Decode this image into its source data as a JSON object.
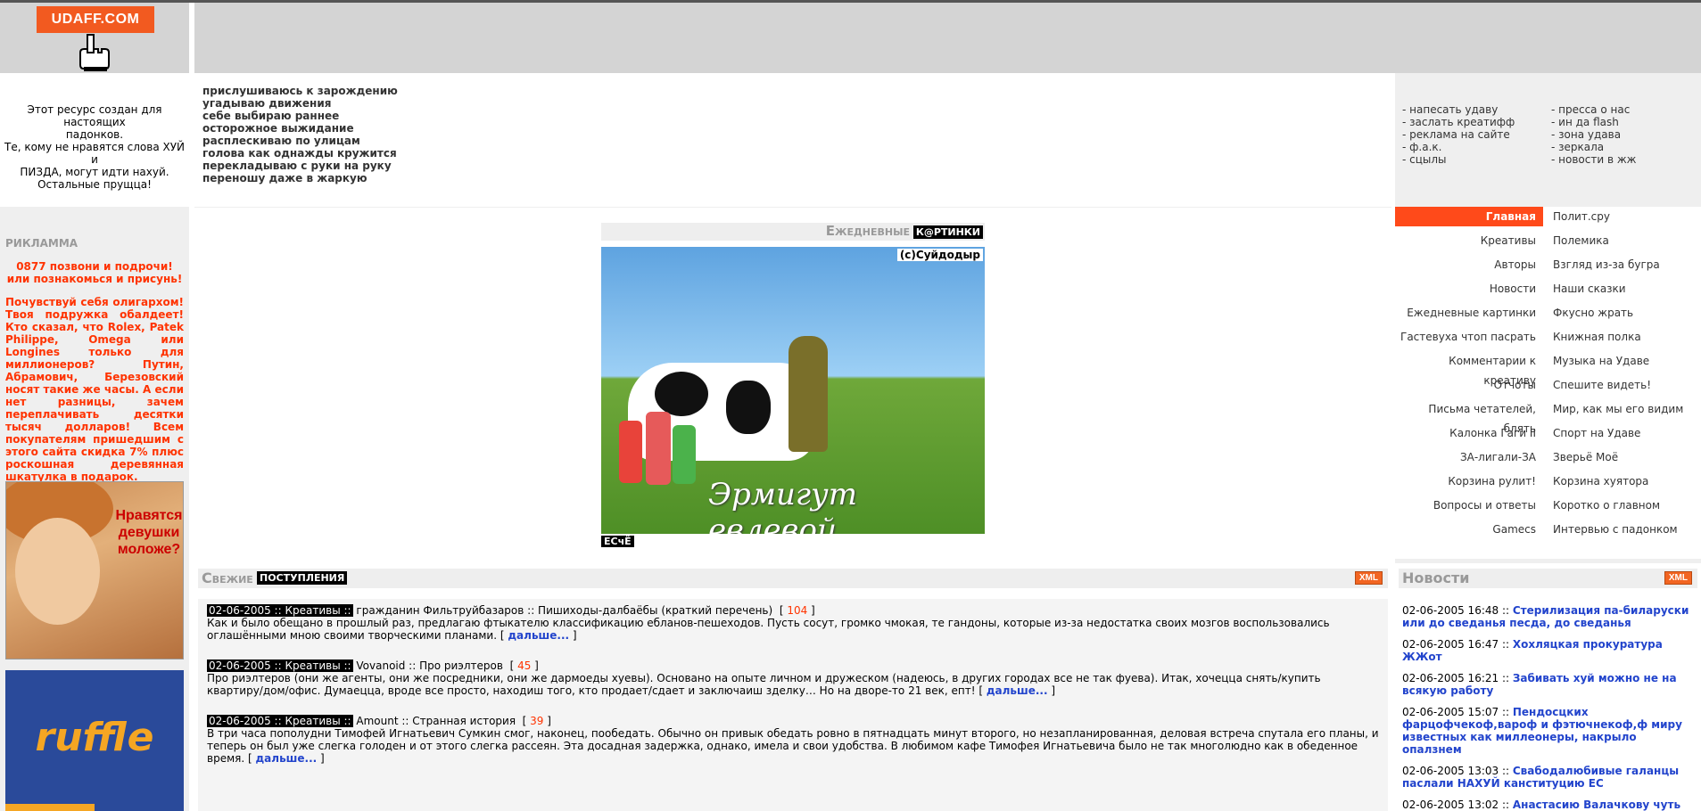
{
  "logo": {
    "text": "UDAFF.COM"
  },
  "left": {
    "intro": [
      "Этот ресурс создан для настоящих",
      "падонков.",
      "Те, кому не нравятся слова ХУЙ и",
      "ПИЗДА, могут идти нахуй.",
      "Остальные прущца!"
    ],
    "ad_title": "РИКЛАММА",
    "ad_phone": "0877 позвони и подрочи! или познакомься и присунь!",
    "ad_watch": "Почувствуй себя олигархом! Твоя подружка обалдеет! Кто сказал, что Rolex, Patek Philippe, Omega или Longines только для миллионеров? Путин, Абрамович, Березовский носят такие же часы. А если нет разницы, зачем переплачивать десятки тысяч долларов! Всем покупателям пришедшим с этого сайта скидка 7% плюс роскошная деревянная шкатулка в подарок.",
    "banner_girl_text": "Нравятся девушки моложе?",
    "banner_ruffle_text": "ruffle"
  },
  "poem": [
    "прислушиваюсь к зарождению",
    "угадываю движения",
    "себе выбираю раннее",
    "осторожное выжидание",
    "расплескиваю по улицам",
    "голова как однажды кружится",
    "перекладываю с руки на руку",
    "переношу даже в жаркую"
  ],
  "daily": {
    "title_a": "Ежедневные",
    "title_b": "К@РТИНКИ",
    "credit": "(с)Суйдодыр",
    "caption": "Эрмигут евлевой",
    "tag": "ЕСчЁ"
  },
  "fresh": {
    "title_a": "Свежие",
    "title_b": "ПОСТУПЛЕНИЯ",
    "xml": "XML",
    "posts": [
      {
        "meta": "02-06-2005 :: Креативы ::",
        "title": "гражданин Фильтруйбазаров :: Пишиходы-далбаёбы (краткий перечень)",
        "count": "104",
        "body": "Как и было обещано в прошлый раз, предлагаю фтыкателю классификацию ебланов-пешеходов. Пусть сосут, громко чмокая, те гандоны, которые из-за недостатка своих мозгов воспользовались оглашёнными мною своими творческими планами.",
        "more": "дальше..."
      },
      {
        "meta": "02-06-2005 :: Креативы ::",
        "title": "Vovanoid :: Про риэлтеров",
        "count": "45",
        "body": "Про риэлтеров (они же агенты, они же посредники, они же дармоеды хуевы). Основано на опыте личном и дружеском (надеюсь, в других городах все не так фуева). Итак, хочецца снять/купить квартиру/дом/офис. Думаецца, вроде все просто, находиш того, кто продает/сдает и заключаиш зделку… Но на дворе-то 21 век, епт!",
        "more": "дальше..."
      },
      {
        "meta": "02-06-2005 :: Креативы ::",
        "title": "Amount :: Странная история",
        "count": "39",
        "body": "В три часа пополудни Тимофей Игнатьевич Сумкин смог, наконец, пообедать. Обычно он привык обедать ровно в пятнадцать минут второго, но незапланированная, деловая встреча спутала его планы, и теперь он был уже слегка голоден и от этого слегка рассеян. Эта досадная задержка, однако, имела и свои удобства. В любимом кафе Тимофея Игнатьевича было не так многолюдно как в обеденное время.",
        "more": "дальше..."
      }
    ]
  },
  "links_left": [
    "- напесать удаву",
    "- заслать креатифф",
    "- реклама на сайте",
    "- ф.а.к.",
    "- сцылы"
  ],
  "links_right": [
    "- пресса о нас",
    "- ин да flash",
    "- зона удава",
    "- зеркала",
    "- новости в жж"
  ],
  "menu": [
    [
      "Главная",
      "Полит.сру"
    ],
    [
      "Креативы",
      "Полемика"
    ],
    [
      "Авторы",
      "Взгляд из-за бугра"
    ],
    [
      "Новости",
      "Наши сказки"
    ],
    [
      "Ежедневные картинки",
      "Фкусно жрать"
    ],
    [
      "Гастевуха чтоп пасрать",
      "Книжная полка"
    ],
    [
      "Комментарии к креативу",
      "Музыка на Удаве"
    ],
    [
      "Отчоты",
      "Спешите видеть!"
    ],
    [
      "Письма четателей, блять",
      "Мир, как мы его видим"
    ],
    [
      "Калонка Гаги II",
      "Спорт на Удаве"
    ],
    [
      "ЗА-лигали-ЗА",
      "Зверьё Моё"
    ],
    [
      "Корзина рулит!",
      "Корзина хуятора"
    ],
    [
      "Вопросы и ответы",
      "Коротко о главном"
    ],
    [
      "Gamecs",
      "Интервью с падонком"
    ]
  ],
  "news": {
    "title": "Новости",
    "xml": "XML",
    "items": [
      {
        "date": "02-06-2005 16:48 ::",
        "link": "Стерилизация па-биларуски или до сведанья песда, до сведанья"
      },
      {
        "date": "02-06-2005 16:47 ::",
        "link": "Хохляцкая прокуратура ЖЖот"
      },
      {
        "date": "02-06-2005 16:21 ::",
        "link": "Забивать хуй можно не на всякую работу"
      },
      {
        "date": "02-06-2005 15:07 ::",
        "link": "Пендосцких фарцофчекоф,вароф и фэтючнекоф,ф миру известных как миллеонеры, накрыло опалзнем"
      },
      {
        "date": "02-06-2005 13:03 ::",
        "link": "Свабодалюбивые галанцы паслали НАХУЙ канституцию ЕС"
      },
      {
        "date": "02-06-2005 13:02 ::",
        "link": "Анастасию Валачкову чуть не"
      }
    ]
  }
}
